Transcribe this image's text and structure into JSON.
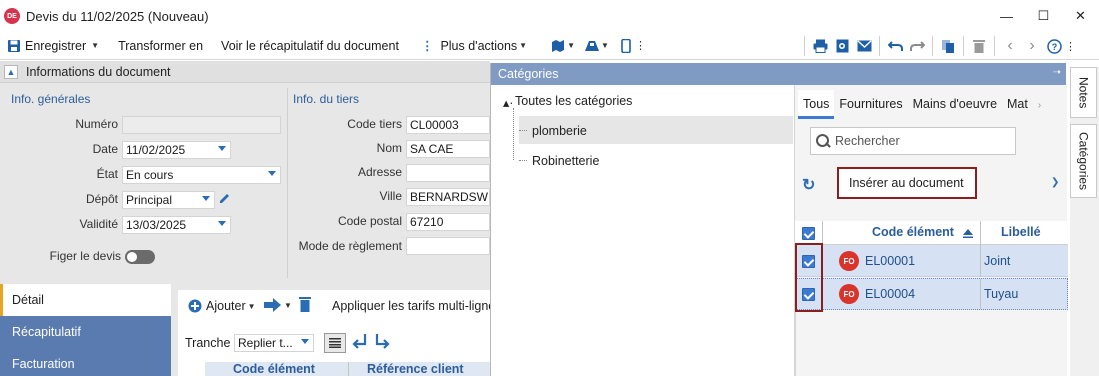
{
  "window": {
    "badge": "DE",
    "title": "Devis du 11/02/2025 (Nouveau)",
    "controls": [
      "—",
      "☐",
      "✕"
    ]
  },
  "toolbar": {
    "save_label": "Enregistrer",
    "transform_label": "Transformer en",
    "summary_label": "Voir le récapitulatif du document",
    "more_actions_label": "Plus d'actions"
  },
  "doc_info": {
    "section_title": "Informations du document",
    "general": {
      "title": "Info. générales",
      "numero_label": "Numéro",
      "numero_value": "",
      "date_label": "Date",
      "date_value": "11/02/2025",
      "etat_label": "État",
      "etat_value": "En cours",
      "depot_label": "Dépôt",
      "depot_value": "Principal",
      "validite_label": "Validité",
      "validite_value": "13/03/2025",
      "figer_label": "Figer le devis"
    },
    "tiers": {
      "title": "Info. du tiers",
      "code_label": "Code tiers",
      "code_value": "CL00003",
      "nom_label": "Nom",
      "nom_value": "SA CAE",
      "adresse_label": "Adresse",
      "adresse_value": "",
      "ville_label": "Ville",
      "ville_value": "BERNARDSWIL",
      "cp_label": "Code postal",
      "cp_value": "67210",
      "reglement_label": "Mode de règlement",
      "reglement_value": ""
    }
  },
  "side_nav": [
    "Détail",
    "Récapitulatif",
    "Facturation"
  ],
  "detail": {
    "add_label": "Ajouter",
    "apply_label": "Appliquer les tarifs multi-ligne",
    "tranche_label": "Tranche",
    "tranche_value": "Replier t...",
    "col_code": "Code élément",
    "col_ref": "Référence client"
  },
  "categories": {
    "header": "Catégories",
    "tree": [
      "Toutes les catégories",
      "plomberie",
      "Robinetterie"
    ],
    "tabs": [
      "Tous",
      "Fournitures",
      "Mains d'oeuvre",
      "Mat"
    ],
    "search_placeholder": "Rechercher",
    "insert_label": "Insérer au document",
    "col_code": "Code élément",
    "col_libelle": "Libellé",
    "rows": [
      {
        "badge": "FO",
        "code": "EL00001",
        "libelle": "Joint"
      },
      {
        "badge": "FO",
        "code": "EL00004",
        "libelle": "Tuyau"
      }
    ]
  },
  "vertical_tabs": [
    "Notes",
    "Catégories"
  ],
  "colors": {
    "accent_blue": "#2a6db5",
    "header_blue": "#7f9ac3",
    "nav_blue": "#5a7bb0",
    "highlight_red": "#8b1e1e",
    "badge_red": "#d9342b"
  }
}
